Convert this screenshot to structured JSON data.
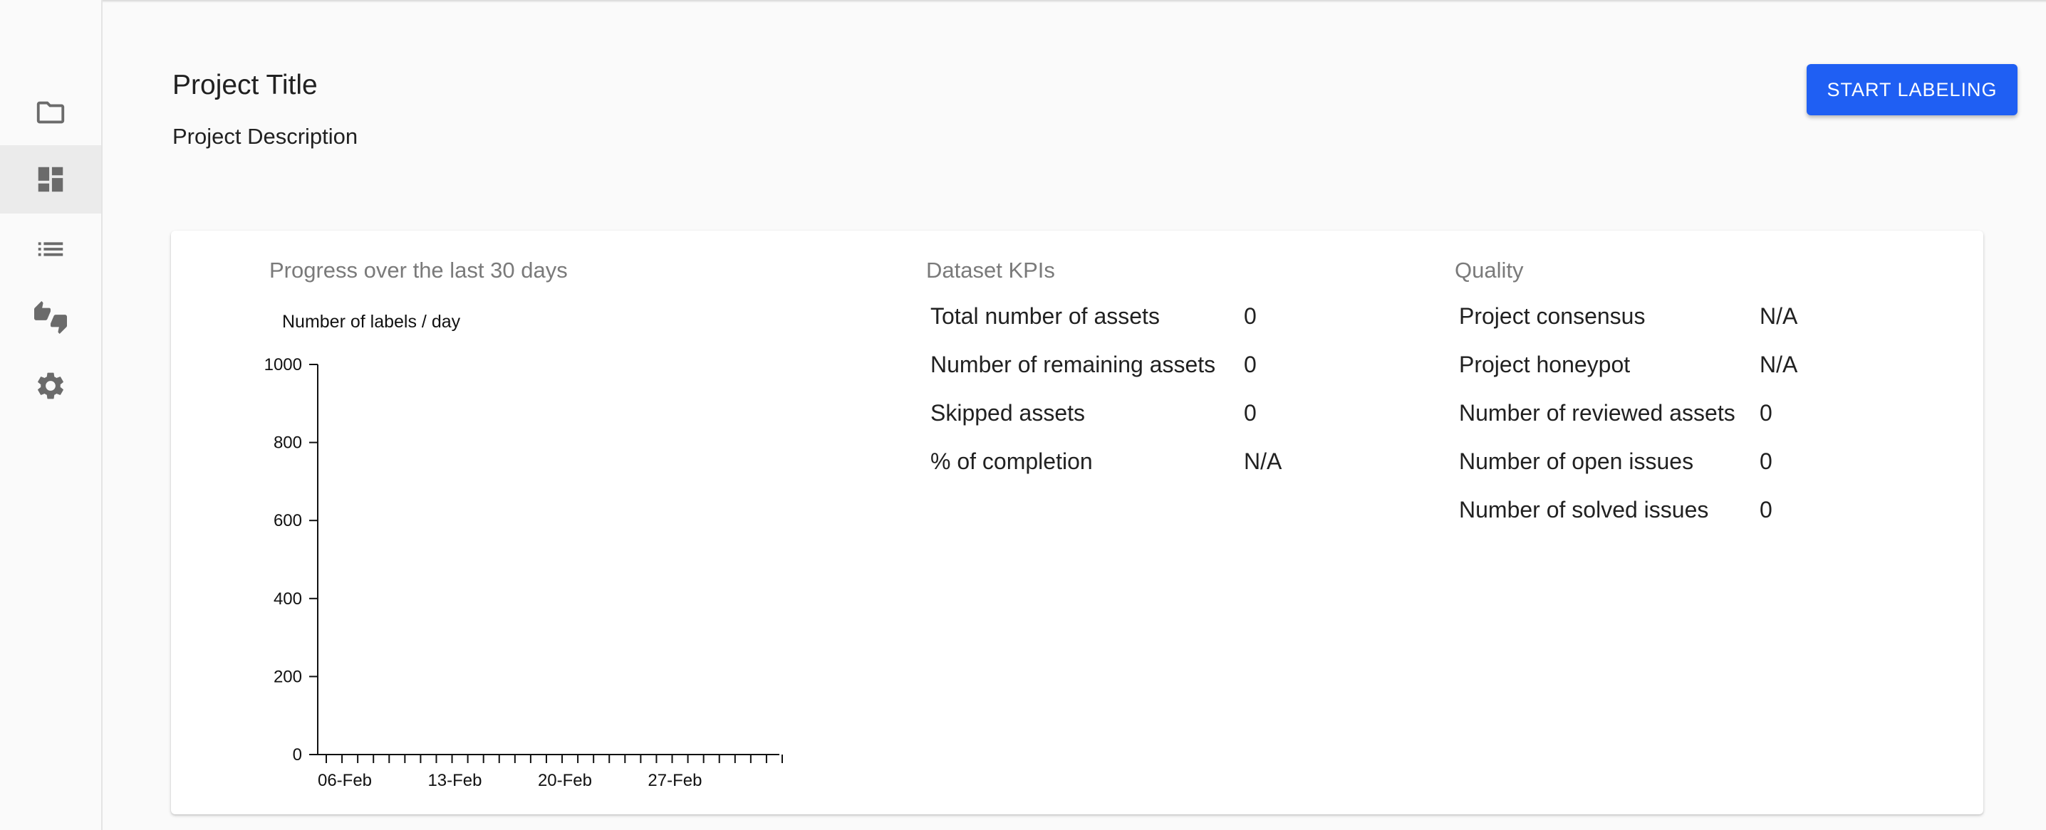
{
  "sidebar": {
    "items": [
      {
        "icon": "folder-icon",
        "active": false
      },
      {
        "icon": "dashboard-icon",
        "active": true
      },
      {
        "icon": "list-icon",
        "active": false
      },
      {
        "icon": "thumbs-up-down-icon",
        "active": false
      },
      {
        "icon": "settings-gear-icon",
        "active": false
      }
    ]
  },
  "header": {
    "title": "Project Title",
    "description": "Project Description",
    "start_button_label": "START LABELING"
  },
  "progress": {
    "heading": "Progress over the last 30 days",
    "ylabel": "Number of labels / day"
  },
  "chart_data": {
    "type": "bar",
    "title": "Progress over the last 30 days",
    "ylabel": "Number of labels / day",
    "xlabel": "",
    "ylim": [
      0,
      1000
    ],
    "yticks": [
      0,
      200,
      400,
      600,
      800,
      1000
    ],
    "x_tick_labels": [
      "06-Feb",
      "13-Feb",
      "20-Feb",
      "27-Feb"
    ],
    "x_tick_label_indices": [
      0,
      7,
      14,
      21
    ],
    "categories_count": 30,
    "series": [
      {
        "values": [
          0,
          0,
          0,
          0,
          0,
          0,
          0,
          0,
          0,
          0,
          0,
          0,
          0,
          0,
          0,
          0,
          0,
          0,
          0,
          0,
          0,
          0,
          0,
          0,
          0,
          0,
          0,
          0,
          0,
          0
        ]
      }
    ]
  },
  "dataset_kpis": {
    "heading": "Dataset KPIs",
    "rows": [
      {
        "label": "Total number of assets",
        "value": "0"
      },
      {
        "label": "Number of remaining assets",
        "value": "0"
      },
      {
        "label": "Skipped assets",
        "value": "0"
      },
      {
        "label": "% of completion",
        "value": "N/A"
      }
    ]
  },
  "quality": {
    "heading": "Quality",
    "rows": [
      {
        "label": "Project consensus",
        "value": "N/A"
      },
      {
        "label": "Project honeypot",
        "value": "N/A"
      },
      {
        "label": "Number of reviewed assets",
        "value": "0"
      },
      {
        "label": "Number of open issues",
        "value": "0"
      },
      {
        "label": "Number of solved issues",
        "value": "0"
      }
    ]
  },
  "colors": {
    "accent": "#1f5ff3",
    "icon": "#6b6b6b",
    "active_nav_bg": "#ebebeb"
  }
}
